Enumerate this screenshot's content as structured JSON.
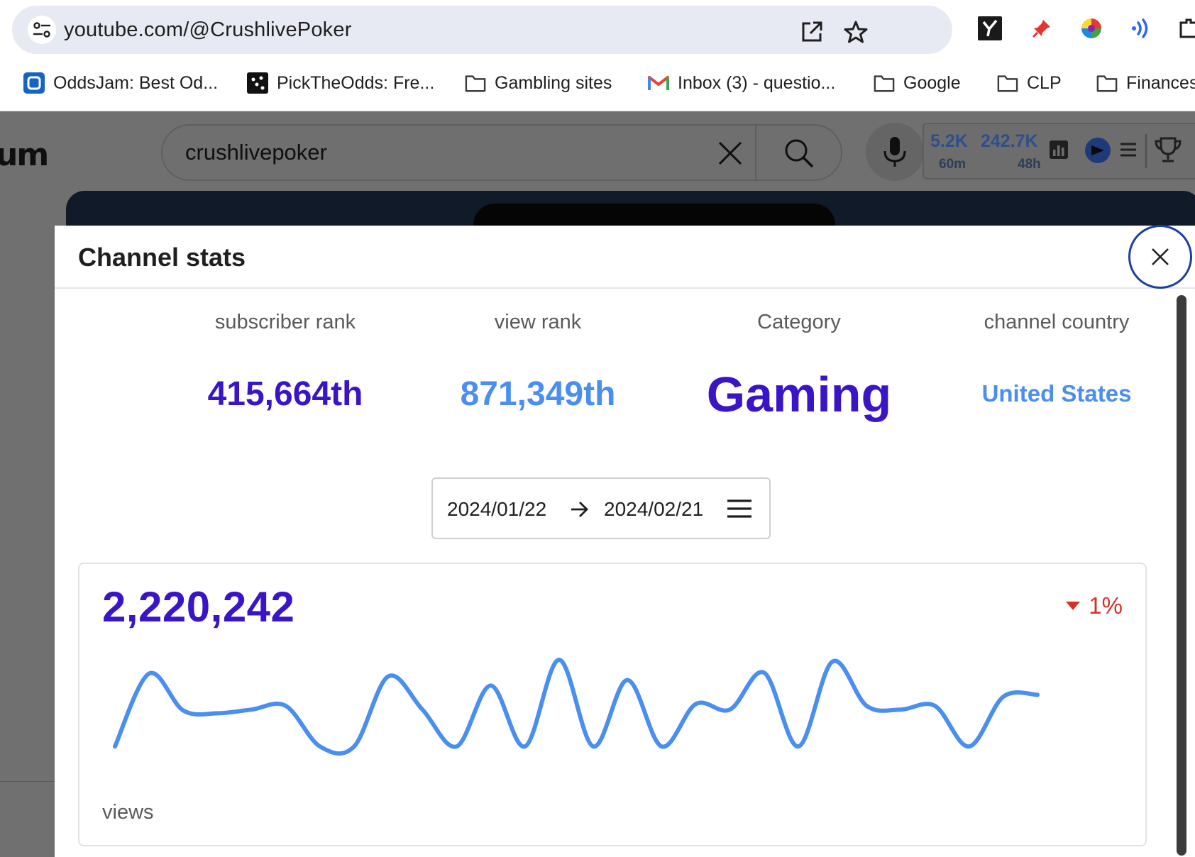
{
  "browser": {
    "url": "youtube.com/@CrushlivePoker",
    "bookmarks": [
      {
        "label": "OddsJam: Best Od..."
      },
      {
        "label": "PickTheOdds: Fre..."
      },
      {
        "label": "Gambling sites"
      },
      {
        "label": "Inbox (3) - questio..."
      },
      {
        "label": "Google"
      },
      {
        "label": "CLP"
      },
      {
        "label": "Finances"
      }
    ]
  },
  "youtube": {
    "logo_fragment": "um",
    "search_value": "crushlivepoker",
    "stats_widget": {
      "value_1": "5.2K",
      "period_1": "60m",
      "value_2": "242.7K",
      "period_2": "48h"
    }
  },
  "modal": {
    "title": "Channel stats",
    "stats": [
      {
        "label": "subscriber rank",
        "value": "415,664th",
        "color": "#3a15c7"
      },
      {
        "label": "view rank",
        "value": "871,349th",
        "color": "#4a8ef0"
      },
      {
        "label": "Category",
        "value": "Gaming",
        "color": "#3a15c7"
      },
      {
        "label": "channel country",
        "value": "United States",
        "color": "#4a8ef0"
      }
    ],
    "date_range": {
      "start": "2024/01/22",
      "end": "2024/02/21"
    },
    "metric": {
      "total": "2,220,242",
      "change": "1%",
      "change_direction": "down",
      "label": "views",
      "line_color": "#4a8ef0",
      "relative_values": [
        0.06,
        0.85,
        0.45,
        0.42,
        0.46,
        0.5,
        0.06,
        0.06,
        0.82,
        0.46,
        0.06,
        0.72,
        0.06,
        1.0,
        0.06,
        0.78,
        0.06,
        0.52,
        0.46,
        0.86,
        0.06,
        0.98,
        0.5,
        0.46,
        0.5,
        0.06,
        0.6,
        0.62
      ]
    }
  }
}
